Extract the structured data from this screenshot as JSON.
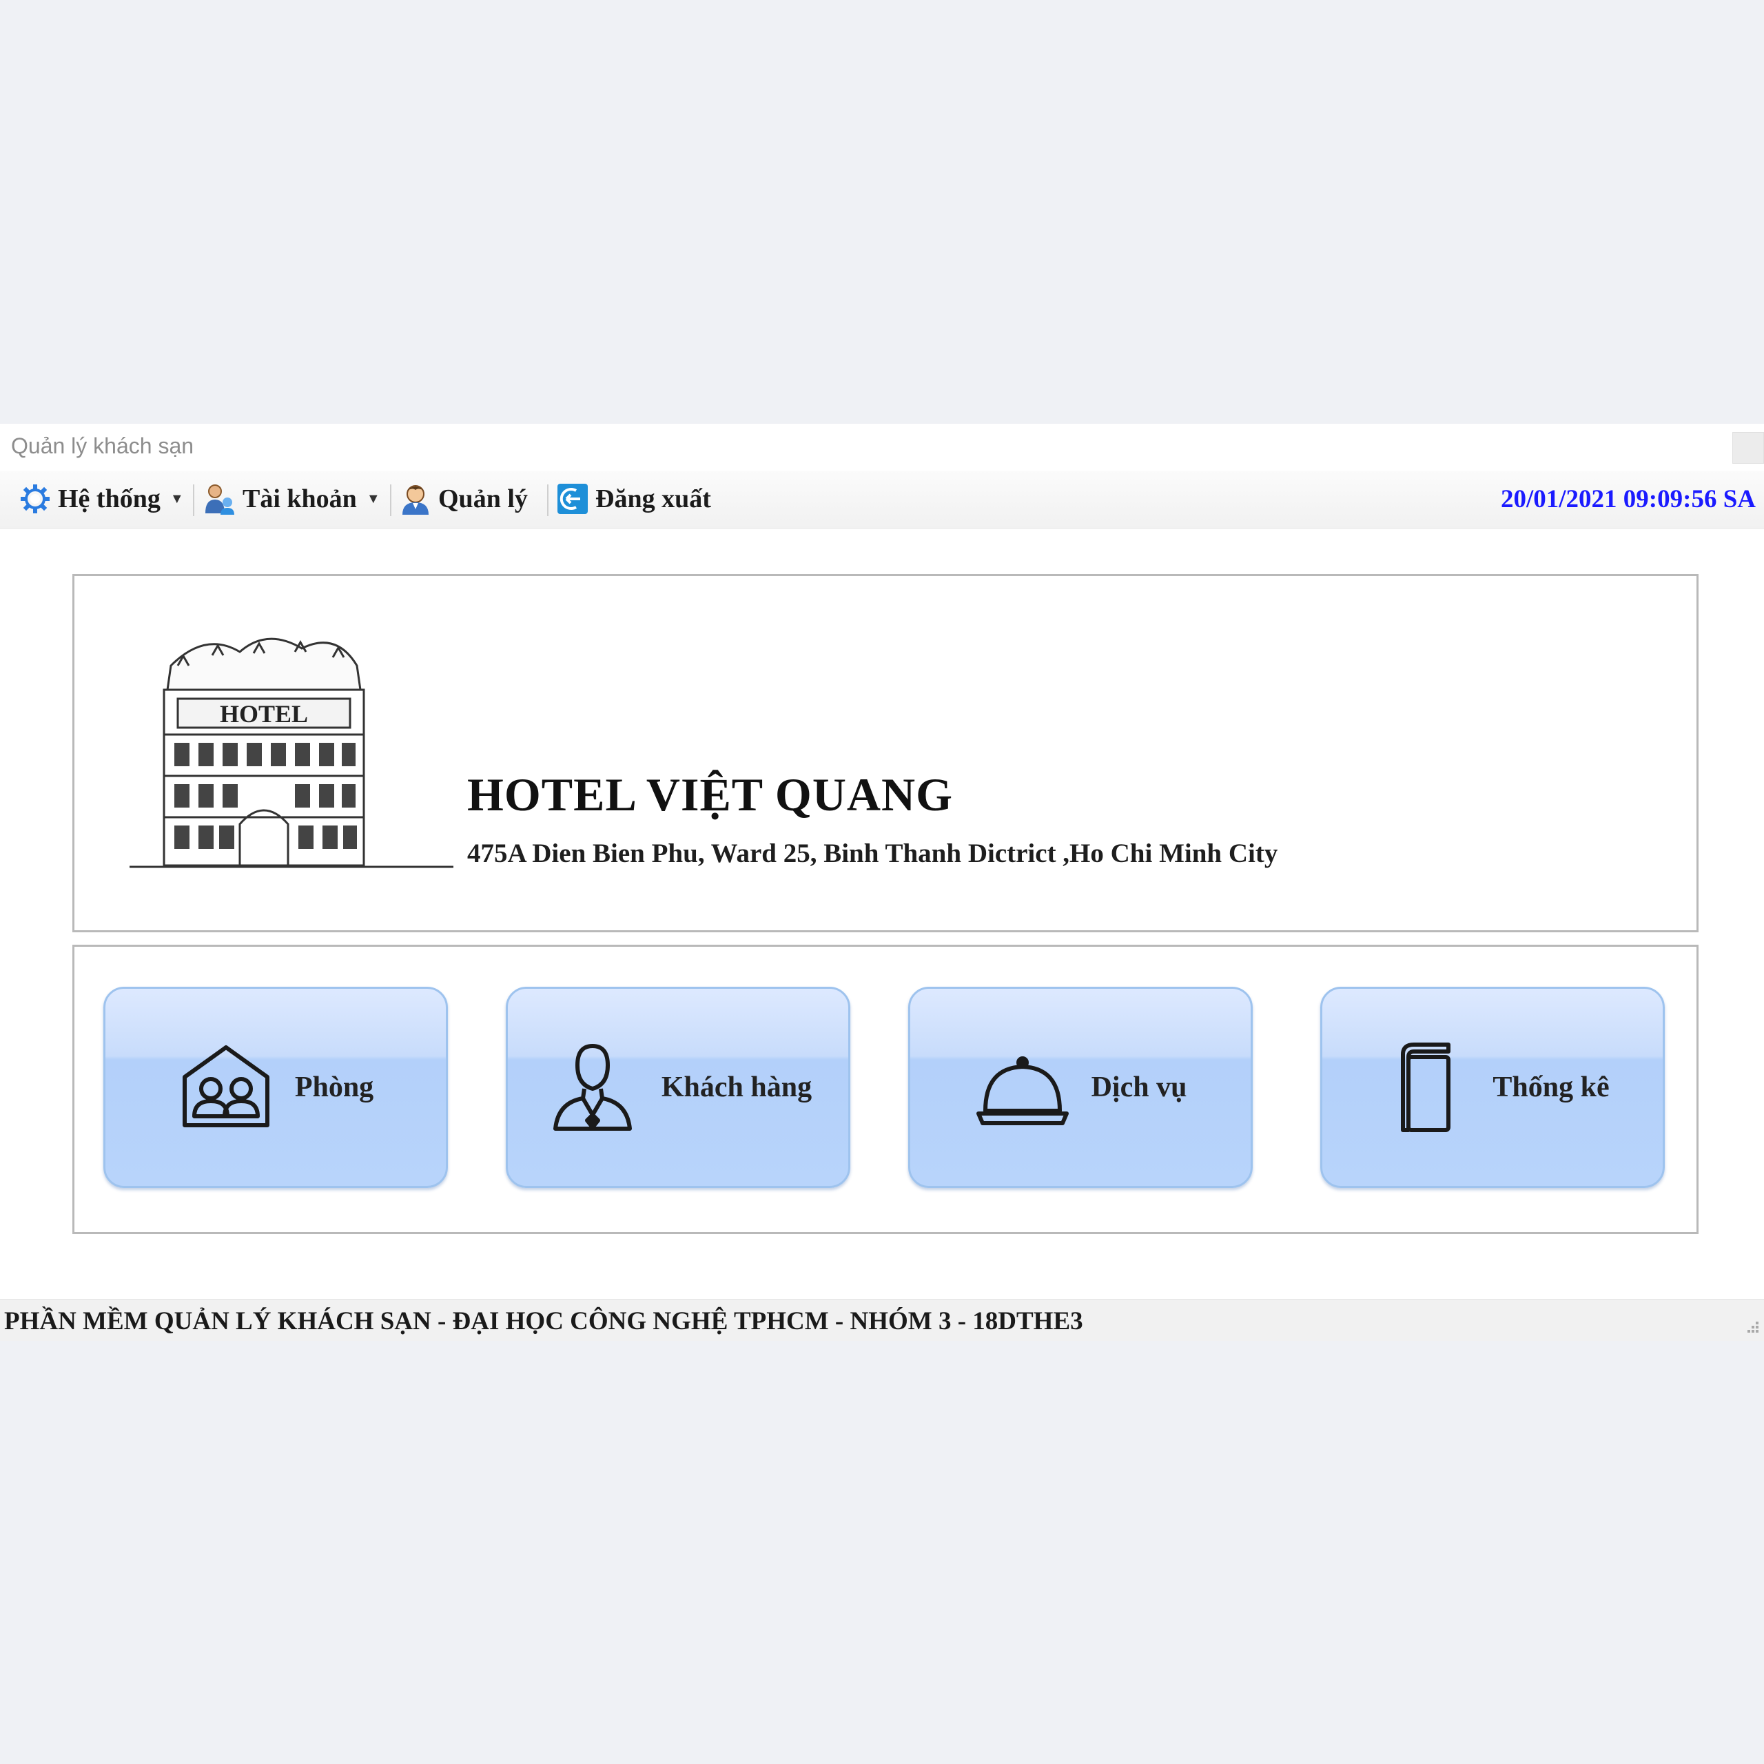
{
  "window": {
    "title": "Quản lý khách sạn"
  },
  "menu": {
    "items": [
      {
        "label": "Hệ thống",
        "icon": "gear-icon",
        "has_dropdown": true
      },
      {
        "label": "Tài khoản",
        "icon": "user-account-icon",
        "has_dropdown": true
      },
      {
        "label": "Quản lý",
        "icon": "manager-icon",
        "has_dropdown": false
      },
      {
        "label": "Đăng xuất",
        "icon": "logout-icon",
        "has_dropdown": false
      }
    ],
    "datetime": "20/01/2021 09:09:56 SA"
  },
  "header": {
    "hotel_name": "HOTEL VIỆT QUANG",
    "address": "475A Dien Bien Phu, Ward 25, Binh Thanh Dictrict ,Ho Chi Minh City",
    "image_sign_text": "HOTEL"
  },
  "tiles": [
    {
      "label": "Phòng",
      "icon": "room-icon"
    },
    {
      "label": "Khách hàng",
      "icon": "customer-icon"
    },
    {
      "label": "Dịch vụ",
      "icon": "service-bell-icon"
    },
    {
      "label": "Thống kê",
      "icon": "statistics-book-icon"
    }
  ],
  "status_bar": {
    "text": "PHẦN MỀM QUẢN LÝ KHÁCH SẠN - ĐẠI HỌC CÔNG NGHỆ TPHCM - NHÓM 3 - 18DTHE3"
  },
  "colors": {
    "datetime": "#1a1aff",
    "tile_fill": "#b8d4fb",
    "tile_border": "#9ec3ee",
    "panel_border": "#b9b9b9",
    "page_background": "#eff1f5"
  }
}
